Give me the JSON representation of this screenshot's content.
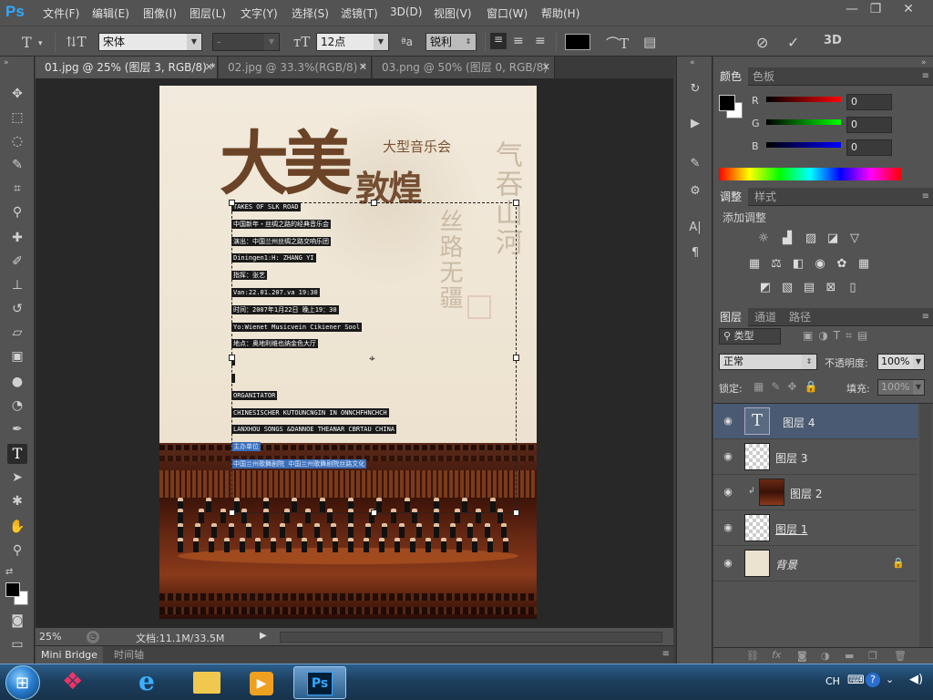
{
  "app": {
    "logo": "Ps",
    "menus": [
      "文件(F)",
      "编辑(E)",
      "图像(I)",
      "图层(L)",
      "文字(Y)",
      "选择(S)",
      "滤镜(T)",
      "3D(D)",
      "视图(V)",
      "窗口(W)",
      "帮助(H)"
    ]
  },
  "options": {
    "font_family": "宋体",
    "font_style": "-",
    "font_size": "12点",
    "aa_label": "ªa",
    "antialias": "锐利",
    "text_color": "#000000",
    "mode_3d": "3D"
  },
  "tabs": [
    {
      "label": "01.jpg @ 25% (图层 3, RGB/8) *",
      "active": true
    },
    {
      "label": "02.jpg @ 33.3%(RGB/8) *",
      "active": false
    },
    {
      "label": "03.png @ 50% (图层 0, RGB/8)",
      "active": false
    }
  ],
  "document": {
    "title_calligraphy": "大美",
    "title_calligraphy_2": "敦煌",
    "subtitle": "大型音乐会",
    "vertical_text_1": "气吞山河",
    "vertical_text_2": "丝路无疆",
    "lines": [
      "TAKES OF SLK ROAD",
      "中国新年・丝绸之路的经典音乐会",
      "演出：中国兰州丝绸之路交响乐团",
      "Diningen1:H: ZHANG YI",
      "指挥：张艺",
      "Van:22.01.207.va 19:30",
      "时间：2007年1月22日 晚上19：30",
      "Yo:Wienet Musicvein Cikiener Sool",
      "地点：奥地利维也纳金色大厅",
      "",
      "",
      "ORGANITATOR",
      "CHINESISCHER KUTOUNCNGIN IN ONNCHFHNCHCH",
      "LANXHOU SONGS &DANNOE THEANAR CBRTAU CHINA",
      "主办单位",
      "中国兰州歌舞剧院 中国兰州歌舞剧院丝路文化"
    ]
  },
  "status": {
    "zoom": "25%",
    "doc_size": "文档:11.1M/33.5M"
  },
  "bottom_tabs": [
    "Mini Bridge",
    "时间轴"
  ],
  "color_panel": {
    "tabs": [
      "颜色",
      "色板"
    ],
    "r_label": "R",
    "g_label": "G",
    "b_label": "B",
    "r": "0",
    "g": "0",
    "b": "0",
    "fg_color": "#000000",
    "bg_color": "#ffffff"
  },
  "adjust_panel": {
    "tabs": [
      "调整",
      "样式"
    ],
    "title": "添加调整"
  },
  "layers_panel": {
    "tabs": [
      "图层",
      "通道",
      "路径"
    ],
    "filter_label": "类型",
    "blend_mode": "正常",
    "opacity_label": "不透明度:",
    "opacity": "100%",
    "lock_label": "锁定:",
    "fill_label": "填充:",
    "fill": "100%",
    "layers": [
      {
        "name": "图层 4",
        "type": "text",
        "active": true
      },
      {
        "name": "图层 3",
        "type": "transparent",
        "active": false
      },
      {
        "name": "图层 2",
        "type": "photo",
        "active": false
      },
      {
        "name": "图层 1",
        "type": "transparent",
        "active": false
      },
      {
        "name": "背景",
        "type": "background",
        "active": false
      }
    ]
  },
  "taskbar": {
    "ime": "CH",
    "ps_label": "Ps"
  }
}
